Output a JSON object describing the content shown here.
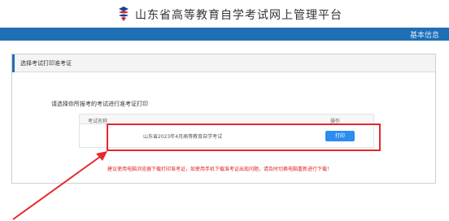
{
  "header": {
    "title": "山东省高等教育自学考试网上管理平台",
    "logo_icon": "exam-logo-icon",
    "brand_color": "#1f6fb5"
  },
  "navbar": {
    "link_label": "基本信息"
  },
  "panel": {
    "title": "选择考试打印准考证",
    "instruction": "请选择你所报考的考试进行准考证打印",
    "table": {
      "headers": [
        "考试名称",
        "操作"
      ],
      "rows": [
        {
          "exam_name": "山东省2023年4月高等教育自学考试",
          "action_label": "打印"
        }
      ]
    },
    "warning": "建议使用电脑浏览器下载打印准考证，如使用手机下载准考证出现问题，请及时切换电脑重新进行下载！",
    "warning_color": "#e02020",
    "button_color": "#2d8cf0"
  },
  "annotation": {
    "highlight_color": "#e8262b"
  }
}
